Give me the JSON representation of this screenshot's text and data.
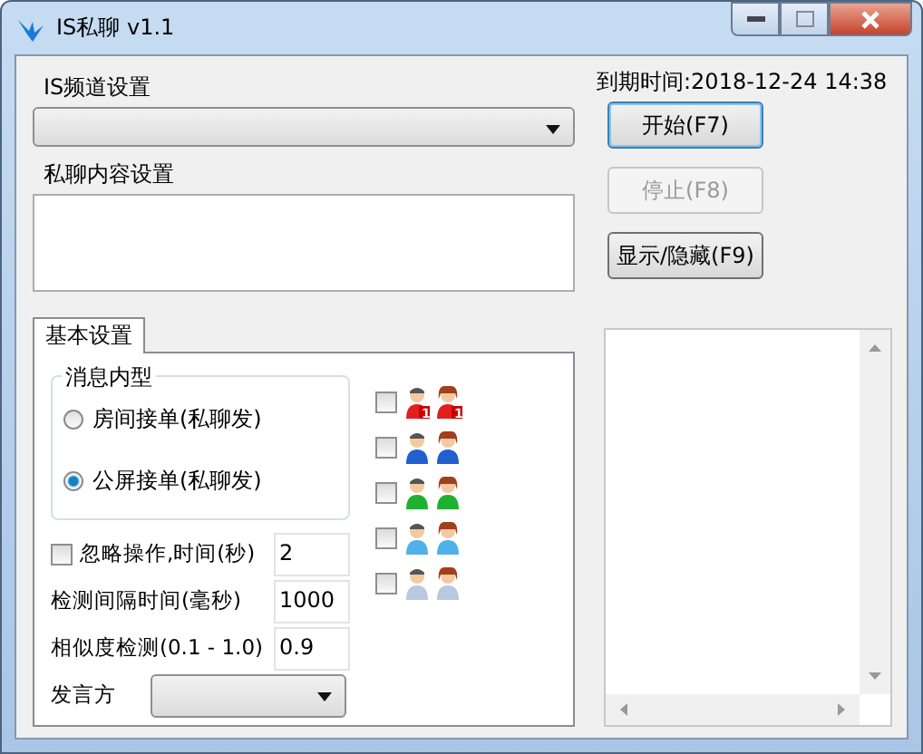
{
  "window": {
    "title": "IS私聊 v1.1"
  },
  "channel_group": {
    "label": "IS频道设置"
  },
  "content_group": {
    "label": "私聊内容设置"
  },
  "expiry": "到期时间:2018-12-24 14:38",
  "buttons": [
    {
      "label": "开始(F7)",
      "disabled": false,
      "focused": true
    },
    {
      "label": "停止(F8)",
      "disabled": true,
      "focused": false
    },
    {
      "label": "显示/隐藏(F9)",
      "disabled": false,
      "focused": false
    }
  ],
  "tabs": [
    {
      "label": "基本设置",
      "selected": true
    }
  ],
  "message_type": {
    "label": "消息内型",
    "options": [
      {
        "label": "房间接单(私聊发)",
        "selected": false
      },
      {
        "label": "公屏接单(私聊发)",
        "selected": true
      }
    ]
  },
  "settings": [
    {
      "kind": "check",
      "label": "忽略操作,时间(秒)",
      "checked": false,
      "value": "2"
    },
    {
      "kind": "text",
      "label": "检测间隔时间(毫秒)",
      "value": "1000"
    },
    {
      "kind": "text",
      "label": "相似度检测(0.1 - 1.0)",
      "value": "0.9"
    },
    {
      "kind": "select",
      "label": "发言方"
    }
  ],
  "user_filters": [
    {
      "checked": false,
      "color": "#e02020",
      "badges": [
        "1",
        "1"
      ]
    },
    {
      "checked": false,
      "color": "#2060d0"
    },
    {
      "checked": false,
      "color": "#20b030"
    },
    {
      "checked": false,
      "color": "#50b0e8"
    },
    {
      "checked": false,
      "color": "#b8c8e0"
    }
  ]
}
